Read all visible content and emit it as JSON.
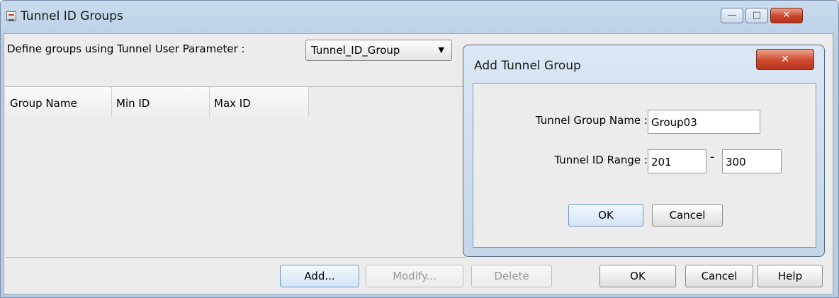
{
  "window": {
    "title": "Tunnel ID Groups",
    "controls": {
      "minimize": "—",
      "maximize": "□",
      "close": "✕"
    }
  },
  "param": {
    "label": "Define groups using Tunnel User Parameter :",
    "selected": "Tunnel_ID_Group"
  },
  "table": {
    "columns": [
      "Group Name",
      "Min ID",
      "Max ID"
    ],
    "rows": []
  },
  "buttons": {
    "add": "Add...",
    "modify": "Modify...",
    "delete": "Delete",
    "ok": "OK",
    "cancel": "Cancel",
    "help": "Help"
  },
  "dialog": {
    "title": "Add Tunnel Group",
    "close": "✕",
    "name_label": "Tunnel Group Name :",
    "name_value": "Group03",
    "range_label": "Tunnel ID Range :",
    "range_min": "201",
    "range_sep": "-",
    "range_max": "300",
    "ok": "OK",
    "cancel": "Cancel"
  },
  "colors": {
    "titlebar": "#c9dcef",
    "close": "#c8452c",
    "panel": "#ececec"
  }
}
